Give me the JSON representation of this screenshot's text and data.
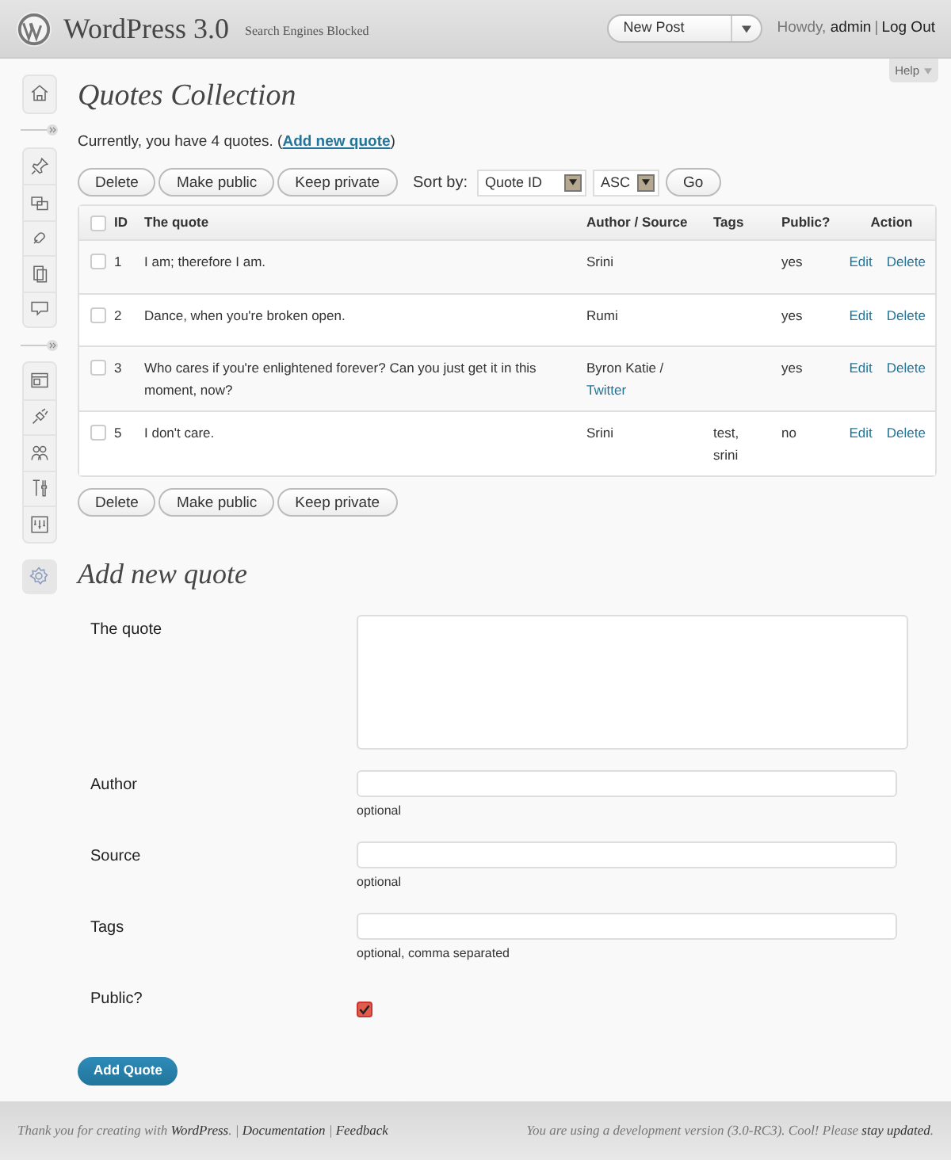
{
  "header": {
    "site_title": "WordPress 3.0",
    "site_note": "Search Engines Blocked",
    "favorites": "New Post",
    "greeting": "Howdy, ",
    "username": "admin",
    "separator": "|",
    "logout": "Log Out"
  },
  "help": "Help",
  "page_title": "Quotes Collection",
  "summary": {
    "text": "Currently, you have 4 quotes. (",
    "link": "Add new quote",
    "after": ")"
  },
  "bulk_actions": [
    "Delete",
    "Make public",
    "Keep private"
  ],
  "sort": {
    "label": "Sort by:",
    "field": "Quote ID",
    "order": "ASC",
    "go": "Go"
  },
  "table": {
    "select_all": {
      "checked": false
    },
    "columns": [
      "ID",
      "The quote",
      "Author / Source",
      "Tags",
      "Public?",
      "Action"
    ],
    "rows": [
      {
        "checked": false,
        "id": "1",
        "quote": "I am; therefore I am.",
        "author": "Srini",
        "tags": "",
        "public": "yes",
        "actions": [
          "Edit",
          "Delete"
        ]
      },
      {
        "checked": false,
        "id": "2",
        "quote": "Dance, when you're broken open.",
        "author": "Rumi",
        "tags": "",
        "public": "yes",
        "actions": [
          "Edit",
          "Delete"
        ]
      },
      {
        "checked": false,
        "id": "3",
        "quote": "Who cares if you're enlightened forever? Can you just get it in this moment, now?",
        "author": "Byron Katie /",
        "source": "Twitter",
        "tags": "",
        "public": "yes",
        "actions": [
          "Edit",
          "Delete"
        ]
      },
      {
        "checked": false,
        "id": "5",
        "quote": "I don't care.",
        "author": "Srini",
        "tags": "test, srini",
        "public": "no",
        "actions": [
          "Edit",
          "Delete"
        ]
      }
    ]
  },
  "bulk_actions_bottom": [
    "Delete",
    "Make public",
    "Keep private"
  ],
  "form": {
    "title": "Add new quote",
    "fields": [
      {
        "kind": "textarea",
        "label": "The quote"
      },
      {
        "kind": "text",
        "label": "Author",
        "hint": "optional"
      },
      {
        "kind": "text",
        "label": "Source",
        "hint": "optional"
      },
      {
        "kind": "text",
        "label": "Tags",
        "hint": "optional, comma separated"
      },
      {
        "kind": "checkbox",
        "label": "Public?",
        "checked": true
      }
    ],
    "submit": "Add Quote"
  },
  "footer": {
    "left": {
      "text": "Thank you for creating with ",
      "brand": "WordPress",
      "brand_after": ".",
      "separator": "|",
      "links": [
        "Documentation",
        "Feedback"
      ]
    },
    "right": {
      "text": "You are using a development version (3.0-RC3). Cool! Please ",
      "link": "stay updated",
      "after": "."
    }
  }
}
